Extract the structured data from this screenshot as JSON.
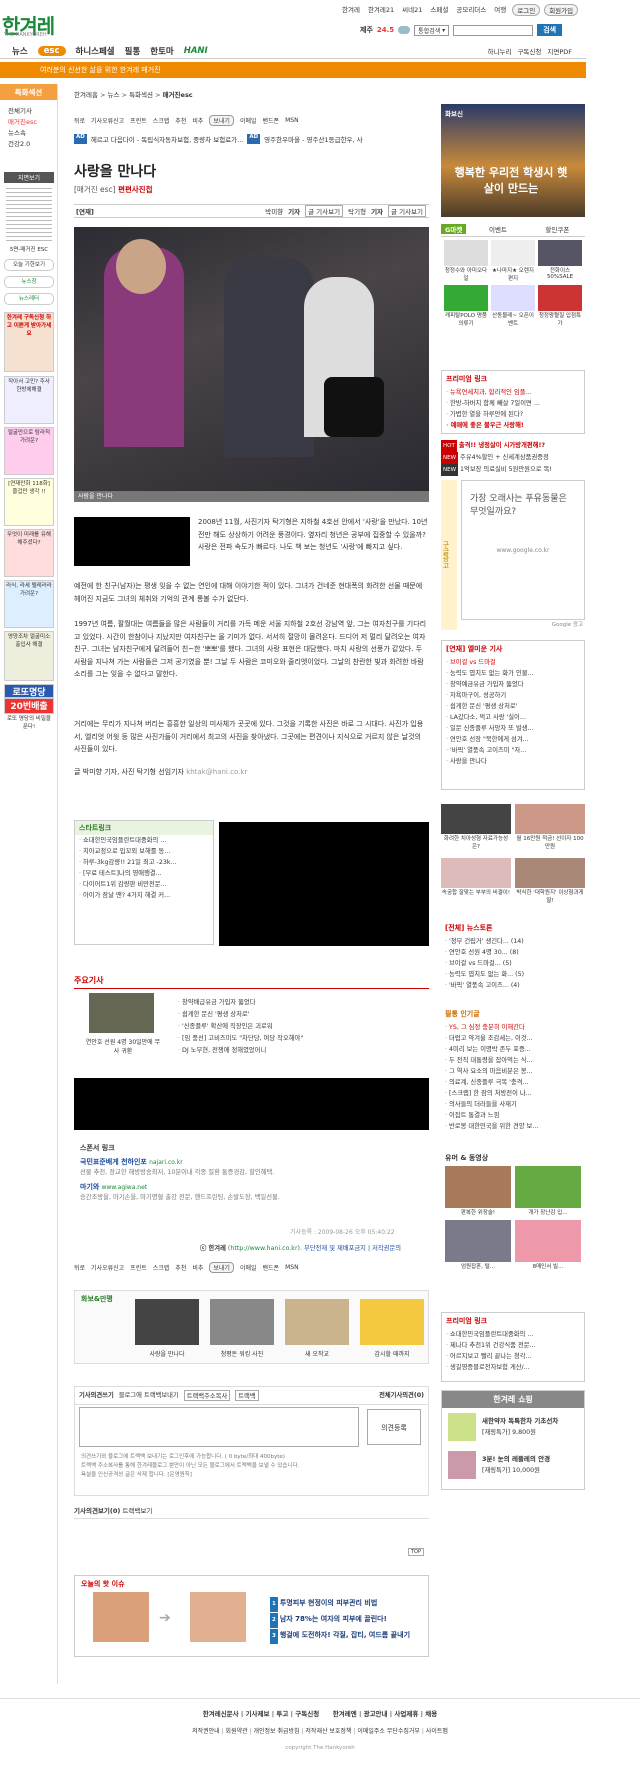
{
  "header": {
    "logo": "한겨레",
    "logo_sub": "THE HANKYOREH",
    "top_links": [
      "한겨레",
      "한겨레21",
      "씨네21",
      "스페셜",
      "공모리더스",
      "여행"
    ],
    "login": "로그인",
    "join": "회원가입",
    "weather_city": "제주",
    "weather_temp": "24.5",
    "search_scope": "통합검색",
    "search_button": "검색"
  },
  "nav": {
    "items": [
      "뉴스",
      "esc",
      "하니스페셜",
      "필통",
      "한토마",
      "HANI"
    ],
    "right": [
      "하니누리",
      "구독신청",
      "지면PDF"
    ],
    "band": "여러분의 신선한 삶을 위한 한겨레 매거진"
  },
  "left": {
    "head": "특화섹션",
    "menu": [
      "전체기사",
      "매거진esc",
      "뉴스속",
      "건강2.0"
    ],
    "pdf_label": "지면보기",
    "pdf_caption": "5면-매거진 ESC",
    "btn1": "오늘 기한보기",
    "btn2": "뉴스창",
    "btn3": "뉴스레터",
    "ad1": "한겨레 구독신청 하고 이쁜게 받아가세요",
    "ad2": "작아서 고민? 주사 한방에해결",
    "ad3": "얼굴만으로 탐라적 가려운?",
    "ad4": "[연재만화 118화] 즐겁만 생각 !!",
    "ad5": "무엇이 미래를 유해 해주셨다?",
    "ad6": "라식, 라세 텔레러라 가려운?",
    "ad7": "영양조차 얼굴미소 출입사 해결",
    "ad8": "로또명당",
    "ad9": "20번배출",
    "ad10": "로또 명당의 비밀을 푼다!"
  },
  "article": {
    "crumb": [
      "한겨레홈",
      "뉴스",
      "특화섹션",
      "매거진esc"
    ],
    "tools": [
      "뒤로",
      "기사오류신고",
      "프린트",
      "스크랩",
      "추천",
      "비추"
    ],
    "tools_r": [
      "보내기",
      "이메일",
      "밴드폰",
      "MSN"
    ],
    "adline1_tag": "AD",
    "adline1": "헤르고 다음다이 - 독립식자동차보험, 중량차 보험료가...",
    "adline2_tag": "AD",
    "adline2": "영주한우마을 - 영주산1등급한우, 사",
    "title": "사랑을 만나다",
    "section": "[매거진 esc]",
    "series": "편편사진첩",
    "byline_label": "[연재]",
    "writer1": "박미향",
    "writer2": "탁기형",
    "writer_suffix": "기자",
    "blog": "글 기사보기",
    "caption": "사람을 만나다",
    "para1": "2008년 11월, 사진기자 탁기형은 지하철 4호선 안에서 '사랑'을 만났다. 10년 전만 해도 상상하기 어려운 풍경이다. 옆자리 청년은 공부에 집중할 수 있을까? 사랑은 전파 속도가 빠르다. 나도 책 보는 청년도 '사랑'에 빠지고 싶다.",
    "para2": "예전에 한 친구(남자)는 평생 잊을 수 없는 연인에 대해 이야기한 적이 있다. 그녀가 건네준 현대폭의 화려한 선물 때문에 헤어진 지금도 그녀의 체취와 기억의 관계 롱볼 수가 없단다.",
    "para3": "1997년 여름, 팔월대는 여름들을 많은 사람들이 거리를 가득 메운 서울 지하철 2호선 강남역 앞, 그는 여자친구를 기다리고 있었다. 시간이 한참이나 지났지만 여자친구는 올 기미가 없다. 서서히 절망이 몰려온다. 드디어 저 멀리 달려오는 여자친구. 그녀는 남자친구에게 달려들어 친~한 '뽀뽀'를 했다. 그녀의 사랑 표현은 대담했다. 마치 사랑의 선풍가 같았다. 두 사람을 지나쳐 가는 사람들은 그저 공기였을 뿐! 그날 두 사람은 코미오와 줄리엣이었다. 그날의 찬란한 빛과 화려한 바람소리를 그는 잊을 수 없다고 말한다.",
    "para4": "거리에는 무리가 지나쳐 버리는 흥흥한 일상의 미사체가 곳곳에 있다. 그것을 기록한 사진은 바로 그 시대다. 사진가 입용서, 엘리엇 어윗 등 많은 사진가들이 거리에서 최고의 사진을 찾아냈다. 그곳에는 편견이나 지식으로 거르지 않은 날것의 사진들이 있다.",
    "sign": "글 박미향 기자, 사진 탁기형 선임기자",
    "email": "khtak@hani.co.kr"
  },
  "startlink": {
    "title": "스타트링크",
    "items": [
      "쇼대한민국임플란트대중화의 ...",
      "치아교정으로 입꼬외 보해를 동...",
      "하루-3kg감량!! 21일 최고 -23k...",
      "[무료 테스트]나의 영애행결...",
      "다이어트1위 감량판 비만전문...",
      "아이가 잠날 땐? 4가지 해결 커..."
    ]
  },
  "major": {
    "title": "주요기사",
    "photo_caption": "연안호 선원 4명 30일만에 무사 귀환",
    "items": [
      "창약배급유금 가입자 뚫었다",
      "쉽게한 문신 '평생 상처로'",
      "'신종플루' 확산에 직장인은 괴로워",
      "[임 풍선] 고비즈미도 \"차단당, 여당 작오해야\"",
      "DJ 노무현, 전쟁에 정해였었어니"
    ]
  },
  "sponsor": {
    "title": "스폰서 링크",
    "s1_name": "국민표준배게 천하인포",
    "s1_url": "najari.co.kr",
    "s1_desc": "선물 추천, 정교한 해방방송최저, 10분이내 각종 질환 통증경감, 할인혜택.",
    "s2_name": "마기와",
    "s2_url": "www.agiwa.net",
    "s2_desc": "승간조방을, 마기손을, 마기명혈 출강 전문, 핸드프린팅, 손발도장, 백일선물."
  },
  "meta": {
    "registered": "기사등록 : 2009-08-26 오후 05:40:22",
    "copyright": "ⓒ 한겨레",
    "copyright_url": "(http://www.hani.co.kr).",
    "copyright_links": "무단전재 및 재배포금지 | 저작권문의"
  },
  "photo_strip": {
    "title": "화보&만평",
    "items": [
      "사랑을 만나다",
      "청평돈 워킹 사진",
      "새 오작교",
      "감시할 때까지"
    ]
  },
  "comment": {
    "title": "기사의견쓰기",
    "sub": "블로그에 트랙백보내기",
    "btn1": "트랙백주소복사",
    "btn2": "트랙백",
    "right": "전체기사의견(0)",
    "submit": "의견등록",
    "note1": "의견쓰기와 블로그에 트랙백 보내기는 로그인후에 가능합니다. ( 0 byte/최대 400byte)",
    "note2": "트랙백 주소복사를 통해 한겨레블로그 뿐만이 아닌 모든 블로그에서 트랙백을 보낼 수 있습니다.",
    "note3": "욕설을 인신공격성 글은 삭제 합니다. [운영원칙]",
    "tab1": "기사의견보기(0)",
    "tab2": "트랙백보기",
    "top": "TOP"
  },
  "issue": {
    "title": "오늘의 핫 이슈",
    "items": [
      "투명피부 현정이의 피부관리 비법",
      "남자 78%는 여자의 피부에 끌린다!",
      "행걸에 도전하자! 각질, 잡티, 여드름 끝내기"
    ]
  },
  "right": {
    "banner_label": "화보신",
    "banner_text": "행복한 우리전 학생시 햇살이 만드는",
    "gmarket": "G마켓",
    "tab2": "이벤트",
    "tab3": "할인쿠폰",
    "goods": [
      "청정수와 아미오다일",
      "★나마지★ 오렌지편지",
      "전화이스 50%SALE",
      "캐피탈POLO 명품의류기",
      "산동물레~ 오픈이벤트",
      "청정왕혈질 입점특가"
    ],
    "premium_title": "프리미엄 링크",
    "premium": [
      "뉴욕연세치과, 합리적인 임플...",
      "한방-하버치 함께 빼살 7일이면 ...",
      "가볍한 열을 하루만에 된다?",
      "예매에 좋은 불우근 사랑해!"
    ],
    "hot1": "출격!! 냉정살이 시가방개편해!?",
    "hot2": "주유4%할인 + 신세계상품권증정",
    "hot3": "1억보장 의료실비 5원만원으로 똑!",
    "gad_side": "구글광고",
    "gad_text": "가장 오래사는 푸유동물은 무엇일까요?",
    "gad_url": "www.google.co.kr",
    "gad_label": "Google 광고",
    "series_title": "[연재] 엘미운 기사",
    "series": [
      "브이걸 vs 드마걸",
      "능력도 엽치도 없는 화가 인물...",
      "창약예금유금 가입자 뚫었다",
      "자욕마구이, 성공하기",
      "쉽게한 문신 '평생 상처로'",
      "LA갔다소, 먹고 사랑 '실이...",
      "일문 신종플루 사망자 또 발생...",
      "연안호 선장 \"북한에게 섬겨...",
      "'바픽' 열풍속 고이즈미 \"자...",
      "사랑을 만나다"
    ],
    "photo_caps": [
      "화려한 치아성형 자료가능성은?",
      "월 16만원 적금! 선이자 100만원",
      "속궁합 잘맞는 부부의 비결이!",
      "박식한 '대학원지' 이상형과게 딸!"
    ],
    "news_title": "[전체] 뉴스토론",
    "news": [
      "'정부 건립거' 생긴다... (14)",
      "연안호 선원 4명 30... (8)",
      "브이걸 vs 드마걸... (5)",
      "능력도 엽치도 없는 화... (5)",
      "'바픽' 열풍속 고이즈... (4)"
    ],
    "blog_title": "필통 인기글",
    "blog": [
      "YS, 그 심정 충분히 이해간다",
      "더럽고 약겨울 조감세는, 이것...",
      "4미리 보는 이명박 존두 포증...",
      "두 전직 대통령을 잡아먹는 식...",
      "그 역사 요소의 마음비분은 봉...",
      "의료계, 신종플루 극복 '충격...",
      "[스크랩] 한 잠의 처방전이 나...",
      "의사들의 더러들을 사재기",
      "이집트 통결과 느낌",
      "반로봉 대한민국을 위한 견양 보..."
    ],
    "ucc_title": "유머 & 동영상",
    "ucc": [
      "판복한 위장술!",
      "개가 장난감 입...",
      "엄원잡혼, 털...",
      "8매인서 빌..."
    ],
    "premium2_title": "프리미엄 링크",
    "premium2": [
      "쇼대한민국임플란트대중화의 ...",
      "제나다 추천1위 건강식품 전문...",
      "어르지보고 빨리 끝나는 청각...",
      "생길영증블로전자보험 게산/..."
    ],
    "shop_title": "한겨레 쇼핑",
    "shop1_name": "새한약자 독특한차 기초선차",
    "shop1_price": "[재링특가] 9,800원",
    "shop2_name": "3분! 눈의 레플레의 안경",
    "shop2_price": "[재링특가] 10,000원"
  },
  "footer": {
    "links1": [
      "한겨레신문사",
      "기사제보",
      "투고",
      "구독신청"
    ],
    "links1b": [
      "한겨레엔",
      "광고안내",
      "사업제휴",
      "채용"
    ],
    "links2": [
      "저작권안내",
      "회원약관",
      "개인정보 취급방침",
      "저작재산 보호정책",
      "이메일주소 무단수집거부",
      "사이트맵"
    ],
    "copy": "copyright The Hankyoreh"
  }
}
